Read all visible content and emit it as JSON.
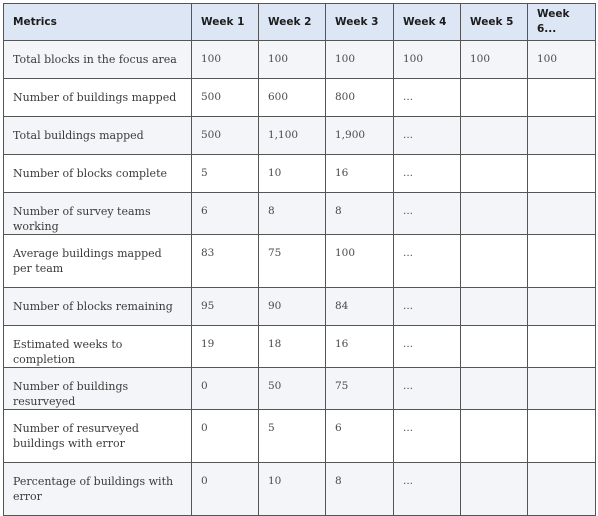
{
  "table": {
    "headers": [
      "Metrics",
      "Week 1",
      "Week 2",
      "Week 3",
      "Week 4",
      "Week 5",
      "Week 6..."
    ],
    "rows": [
      {
        "metric": "Total blocks in the focus area",
        "values": [
          "100",
          "100",
          "100",
          "100",
          "100",
          "100"
        ]
      },
      {
        "metric": "Number of buildings mapped",
        "values": [
          "500",
          "600",
          "800",
          "...",
          "",
          ""
        ]
      },
      {
        "metric": "Total buildings mapped",
        "values": [
          "500",
          "1,100",
          "1,900",
          "...",
          "",
          ""
        ]
      },
      {
        "metric": "Number of blocks complete",
        "values": [
          "5",
          "10",
          "16",
          "...",
          "",
          ""
        ]
      },
      {
        "metric": "Number of survey teams working",
        "values": [
          "6",
          "8",
          "8",
          "...",
          "",
          ""
        ]
      },
      {
        "metric": "Average buildings mapped per team",
        "values": [
          "83",
          "75",
          "100",
          "...",
          "",
          ""
        ]
      },
      {
        "metric": "Number of blocks remaining",
        "values": [
          "95",
          "90",
          "84",
          "...",
          "",
          ""
        ]
      },
      {
        "metric": "Estimated weeks to completion",
        "values": [
          "19",
          "18",
          "16",
          "...",
          "",
          ""
        ]
      },
      {
        "metric": "Number of buildings resurveyed",
        "values": [
          "0",
          "50",
          "75",
          "...",
          "",
          ""
        ]
      },
      {
        "metric": "Number of resurveyed buildings with error",
        "values": [
          "0",
          "5",
          "6",
          "...",
          "",
          ""
        ]
      },
      {
        "metric": "Percentage of buildings with error",
        "values": [
          "0",
          "10",
          "8",
          "...",
          "",
          ""
        ]
      }
    ]
  },
  "colors": {
    "header_bg": "#dde6f4",
    "stripe_bg": "#f4f5f8",
    "border": "#555555"
  }
}
